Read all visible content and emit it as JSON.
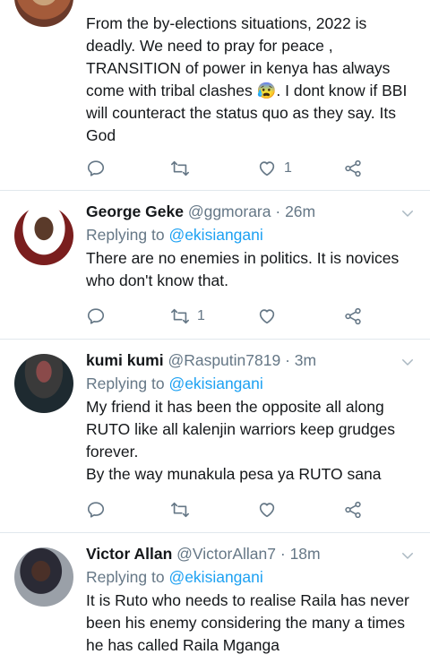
{
  "colors": {
    "link": "#1da1f2",
    "muted": "#657786",
    "divider": "#e1e8ed",
    "text": "#14171a"
  },
  "tweets": [
    {
      "lines": [
        "From the by-elections situations,  2022 is",
        "deadly. We need to pray for peace ,",
        "TRANSITION of power  in kenya has always",
        "come with  tribal clashes 😰. I dont know if BBI",
        "will  counteract the status quo as they say. Its",
        "God"
      ],
      "likes": "1",
      "retweets": ""
    },
    {
      "name": "George Geke",
      "handle": "@ggmorara",
      "dot": "·",
      "time": "26m",
      "replying_prefix": "Replying to",
      "replying_to": "@ekisiangani",
      "lines": [
        "There are no enemies in politics. It is novices",
        "who don't know that."
      ],
      "retweets": "1",
      "likes": ""
    },
    {
      "name": "kumi kumi",
      "handle": "@Rasputin7819",
      "dot": "·",
      "time": "3m",
      "replying_prefix": "Replying to",
      "replying_to": "@ekisiangani",
      "lines": [
        "My friend it has been the opposite all along",
        "RUTO like all kalenjin warriors keep grudges",
        "forever.",
        "By the way munakula pesa ya RUTO sana"
      ],
      "retweets": "",
      "likes": ""
    },
    {
      "name": "Victor Allan",
      "handle": "@VictorAllan7",
      "dot": "·",
      "time": "18m",
      "replying_prefix": "Replying to",
      "replying_to": "@ekisiangani",
      "lines": [
        "It is Ruto who needs to realise Raila has never",
        "been his enemy considering the many a times",
        "he has called Raila Mganga"
      ]
    }
  ],
  "icons": [
    "reply-icon",
    "retweet-icon",
    "like-icon",
    "share-icon",
    "chevron-down-icon"
  ]
}
